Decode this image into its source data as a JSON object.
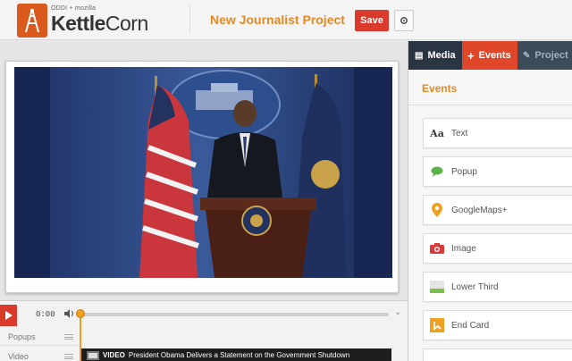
{
  "header": {
    "brand_sub": "ODDI + mozilla",
    "brand_name_a": "Kettle",
    "brand_name_b": "Corn",
    "project_title": "New Journalist Project",
    "save_label": "Save"
  },
  "timeline": {
    "time": "0:00",
    "tracks": [
      {
        "label": "Popups"
      },
      {
        "label": "Video"
      }
    ],
    "video_clip": {
      "tag": "VIDEO",
      "title": "President Obama Delivers a Statement on the Government Shutdown"
    }
  },
  "panel": {
    "tabs": [
      {
        "label": "Media",
        "icon": "media-icon"
      },
      {
        "label": "Events",
        "icon": "plus-icon"
      },
      {
        "label": "Project",
        "icon": "pencil-icon"
      }
    ],
    "heading": "Events",
    "events": [
      {
        "label": "Text",
        "icon": "text-icon",
        "glyph": "Aa"
      },
      {
        "label": "Popup",
        "icon": "speech-bubble-icon"
      },
      {
        "label": "GoogleMaps+",
        "icon": "map-pin-icon"
      },
      {
        "label": "Image",
        "icon": "camera-icon"
      },
      {
        "label": "Lower Third",
        "icon": "lower-third-icon"
      },
      {
        "label": "End Card",
        "icon": "end-card-icon"
      }
    ]
  },
  "colors": {
    "accent_orange": "#e58a22",
    "save_red": "#d93a2b",
    "tab_active": "#e0472a",
    "tab_bar": "#2f3b4a",
    "playhead": "#f0a020"
  }
}
